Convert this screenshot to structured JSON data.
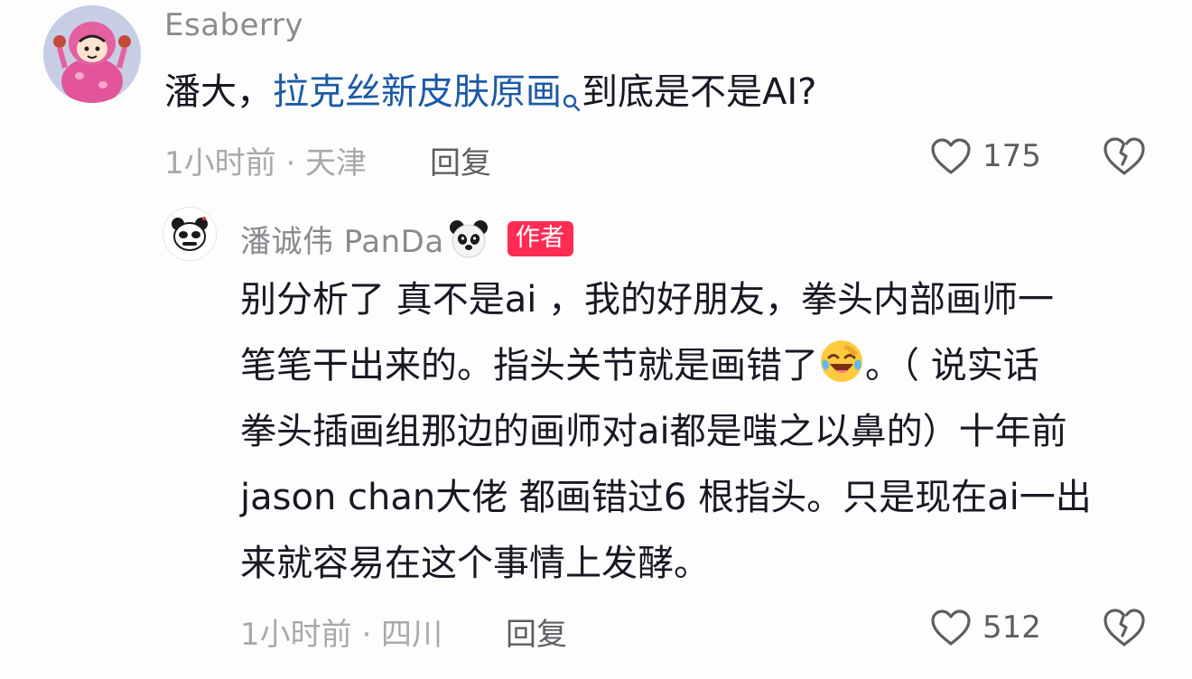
{
  "comment": {
    "username": "Esaberry",
    "text_prefix": "潘大，",
    "link_text": "拉克丝新皮肤原画",
    "text_suffix": "到底是不是AI?",
    "time_location": "1小时前 · 天津",
    "reply_label": "回复",
    "like_count": "175",
    "avatar_icon": "crayon-shin-chan-avatar-icon"
  },
  "reply": {
    "username": "潘诚伟 PanDa",
    "author_badge": "作者",
    "lines": [
      "别分析了 真不是ai ，我的好朋友，拳头内部画师一",
      "笔笔干出来的。指头关节就是画错了",
      "。（ 说实话",
      "拳头插画组那边的画师对ai都是嗤之以鼻的）十年前",
      "jason chan大佬 都画错过6 根指头。只是现在ai一出",
      "来就容易在这个事情上发酵。"
    ],
    "time_location": "1小时前 · 四川",
    "reply_label": "回复",
    "like_count": "512",
    "avatar_icon": "panda-avatar-icon",
    "emoji_name": "laughing-crying-emoji-icon",
    "name_emoji": "panda-face-emoji-icon"
  },
  "colors": {
    "link": "#1c5aa6",
    "badge": "#fe2c55",
    "meta": "#a8a9ad",
    "text": "#161823"
  }
}
